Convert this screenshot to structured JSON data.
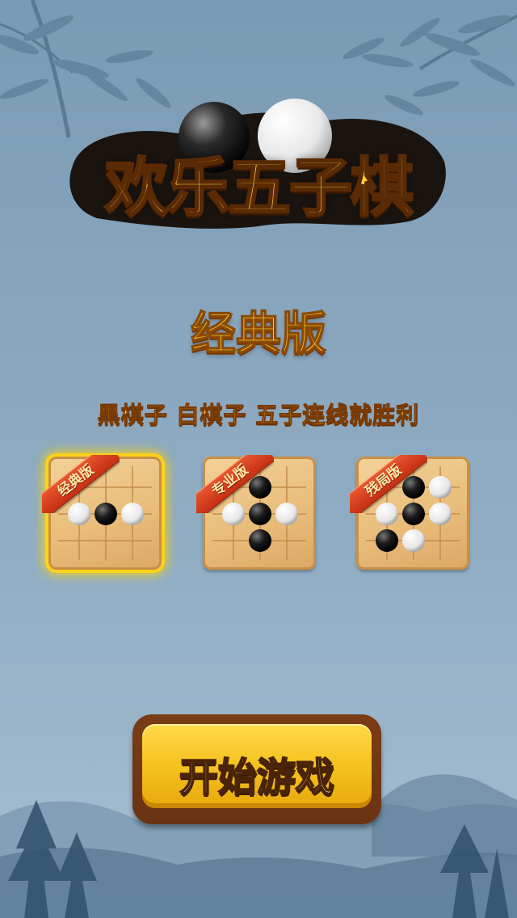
{
  "app": {
    "logo_title": "欢乐五子棋"
  },
  "mode": {
    "title": "经典版",
    "description": "黑棋子 白棋子 五子连线就胜利"
  },
  "boards": [
    {
      "label": "经典版",
      "selected": true
    },
    {
      "label": "专业版",
      "selected": false
    },
    {
      "label": "残局版",
      "selected": false
    }
  ],
  "start_button": {
    "label": "开始游戏"
  },
  "colors": {
    "accent_gold": "#ffd23c",
    "ribbon_red": "#d33a1a",
    "board_wood": "#e9bd7a",
    "button_yellow": "#f5c21e"
  }
}
